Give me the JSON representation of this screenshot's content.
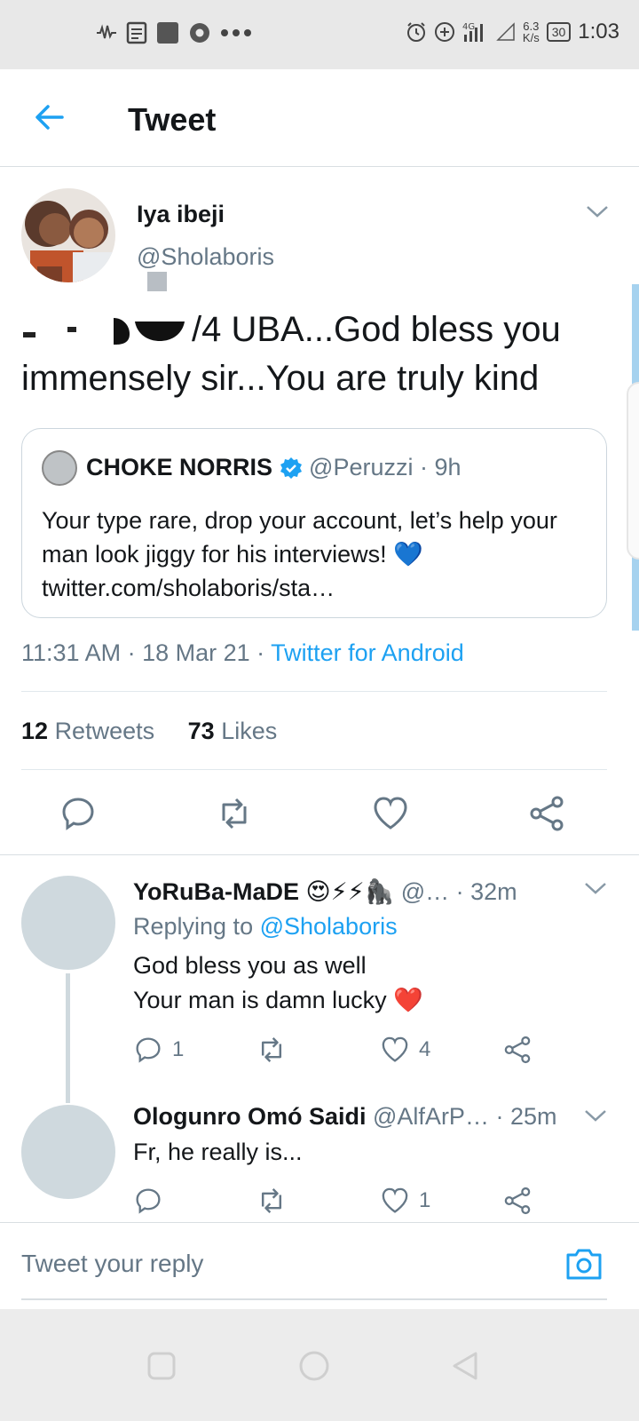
{
  "status_bar": {
    "time": "1:03",
    "network_speed_value": "6.3",
    "network_speed_unit": "K/s",
    "battery": "30",
    "network_type": "4G"
  },
  "header": {
    "title": "Tweet"
  },
  "tweet": {
    "author_name": "Iya ibeji",
    "author_handle": "@Sholaboris",
    "text_line1": "/4 UBA...God bless you",
    "text_line2": "immensely sir...You are truly kind",
    "timestamp": "11:31 AM · 18 Mar 21 · ",
    "source": "Twitter for Android",
    "retweets_count": "12",
    "retweets_label": "Retweets",
    "likes_count": "73",
    "likes_label": "Likes"
  },
  "quoted_tweet": {
    "author_name": "CHOKE NORRIS",
    "author_handle": "@Peruzzi · 9h",
    "text": "Your type rare, drop your account, let’s help your man look jiggy for his interviews! 💙 twitter.com/sholaboris/sta…"
  },
  "replies": [
    {
      "author_name": "YoRuBa-MaDE 😍⚡⚡🦍",
      "author_handle": "@…",
      "time": " · 32m",
      "replying_prefix": "Replying to ",
      "replying_to": "@Sholaboris",
      "text_line1": "God bless you as well",
      "text_line2": "Your man is damn lucky ❤️",
      "reply_count": "1",
      "retweet_count": "",
      "like_count": "4"
    },
    {
      "author_name": "Ologunro Omó Saidi",
      "author_handle": "@AlfArP…",
      "time": " · 25m",
      "text_line1": "Fr, he really is...",
      "reply_count": "",
      "retweet_count": "",
      "like_count": "1"
    }
  ],
  "reply_bar": {
    "placeholder": "Tweet your reply"
  },
  "colors": {
    "accent": "#1da1f2",
    "secondary_text": "#657786",
    "divider": "#e1e8ed"
  }
}
